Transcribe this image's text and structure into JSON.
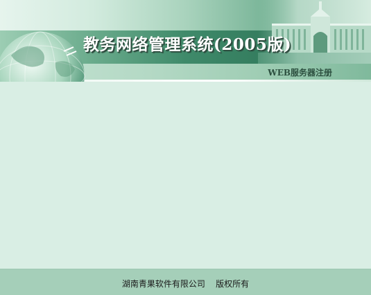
{
  "header": {
    "app_title": "教务网络管理系统(2005版)",
    "page_subtitle": "WEB服务器注册",
    "decor": {
      "globe_icon": "globe-icon",
      "building_image": "building-photo"
    }
  },
  "footer": {
    "copyright": "湖南青果软件有限公司    版权所有"
  },
  "colors": {
    "background": "#d9eee4",
    "footer_background": "#a5cfb9",
    "banner_band": "#3f8a6a"
  }
}
